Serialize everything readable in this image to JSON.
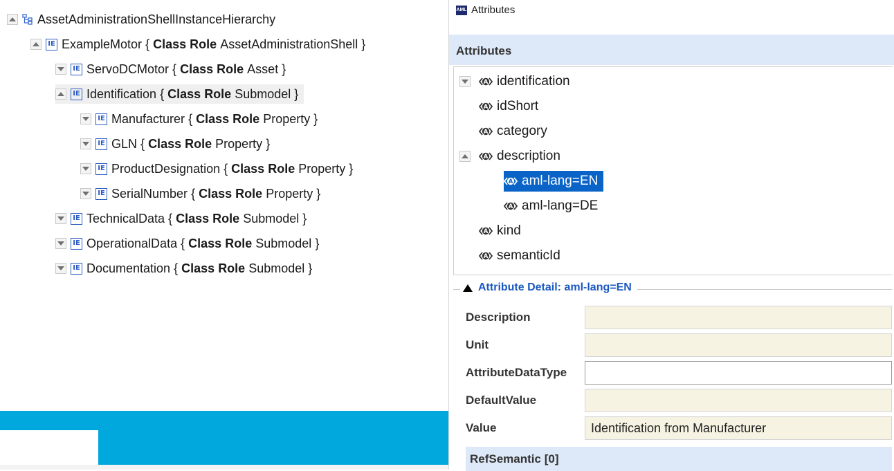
{
  "left_tree": {
    "root": {
      "label": "AssetAdministrationShellInstanceHierarchy",
      "expanded": true
    },
    "items": [
      {
        "name": "ExampleMotor",
        "role": "AssetAdministrationShell",
        "expanded": true,
        "level": 1
      },
      {
        "name": "ServoDCMotor",
        "role": "Asset",
        "expanded": false,
        "level": 2
      },
      {
        "name": "Identification",
        "role": "Submodel",
        "expanded": true,
        "level": 2,
        "selected": true
      },
      {
        "name": "Manufacturer",
        "role": "Property",
        "expanded": false,
        "level": 3
      },
      {
        "name": "GLN",
        "role": "Property",
        "expanded": false,
        "level": 3
      },
      {
        "name": "ProductDesignation",
        "role": "Property",
        "expanded": false,
        "level": 3
      },
      {
        "name": "SerialNumber",
        "role": "Property",
        "expanded": false,
        "level": 3
      },
      {
        "name": "TechnicalData",
        "role": "Submodel",
        "expanded": false,
        "level": 2
      },
      {
        "name": "OperationalData",
        "role": "Submodel",
        "expanded": false,
        "level": 2
      },
      {
        "name": "Documentation",
        "role": "Submodel",
        "expanded": false,
        "level": 2
      }
    ],
    "open_brace": "{",
    "close_brace": "}",
    "class_kw": "Class",
    "role_kw": "Role",
    "ie_icon_text": "IE"
  },
  "right_panel": {
    "window_title": "Attributes",
    "aml_icon_text": "AML",
    "section_title": "Attributes",
    "attributes": [
      {
        "label": "identification",
        "level": 0,
        "expander": "down"
      },
      {
        "label": "idShort",
        "level": 0,
        "expander": "none"
      },
      {
        "label": "category",
        "level": 0,
        "expander": "none"
      },
      {
        "label": "description",
        "level": 0,
        "expander": "up"
      },
      {
        "label": "aml-lang=EN",
        "level": 1,
        "expander": "none",
        "selected": true
      },
      {
        "label": "aml-lang=DE",
        "level": 1,
        "expander": "none"
      },
      {
        "label": "kind",
        "level": 0,
        "expander": "none"
      },
      {
        "label": "semanticId",
        "level": 0,
        "expander": "none"
      }
    ],
    "detail": {
      "legend": "Attribute Detail: aml-lang=EN",
      "fields": [
        {
          "label": "Description",
          "value": "",
          "style": "readonly"
        },
        {
          "label": "Unit",
          "value": "",
          "style": "readonly"
        },
        {
          "label": "AttributeDataType",
          "value": "",
          "style": "editable"
        },
        {
          "label": "DefaultValue",
          "value": "",
          "style": "readonly"
        },
        {
          "label": "Value",
          "value": "Identification from Manufacturer",
          "style": "readonly"
        }
      ],
      "ref_semantic": "RefSemantic [0]"
    }
  },
  "colors": {
    "selection": "#0a64c8",
    "header_band": "#dde9f8",
    "readonly_field": "#f6f3e3",
    "accent_bar": "#00a8dd",
    "ie_blue": "#2a5bc0",
    "legend_blue": "#1a58c0"
  }
}
